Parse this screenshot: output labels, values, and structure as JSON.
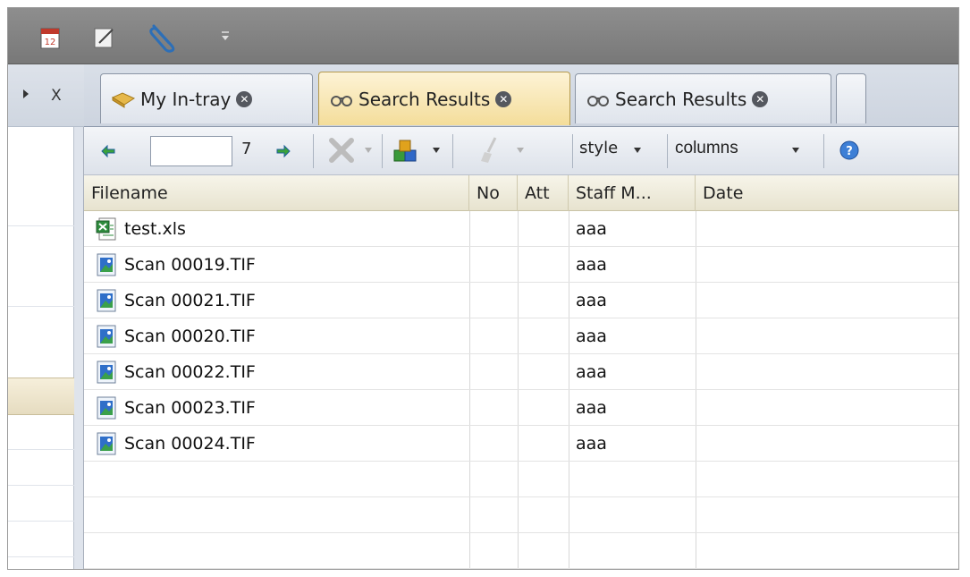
{
  "quick_access": {
    "icons": [
      "calendar-icon",
      "note-icon",
      "paperclip-icon",
      "customize-dropdown-icon"
    ],
    "calendar_number": "12"
  },
  "left_pane": {
    "close_label": "X"
  },
  "tabs": [
    {
      "label": "My In-tray",
      "icon": "in-tray-icon",
      "active": false
    },
    {
      "label": "Search Results",
      "icon": "binoculars-icon",
      "active": true
    },
    {
      "label": "Search Results",
      "icon": "binoculars-icon",
      "active": false
    },
    {
      "label": "",
      "icon": "",
      "active": false
    }
  ],
  "toolbar": {
    "page_value": "",
    "page_count": "7",
    "style_label": "style",
    "columns_label": "columns"
  },
  "grid": {
    "columns": [
      "Filename",
      "No",
      "Att",
      "Staff M...",
      "Date"
    ],
    "rows": [
      {
        "filename": "test.xls",
        "no": "",
        "att": "",
        "staff": "aaa",
        "date": "",
        "icon": "excel-file-icon"
      },
      {
        "filename": "Scan 00019.TIF",
        "no": "",
        "att": "",
        "staff": "aaa",
        "date": "",
        "icon": "image-file-icon"
      },
      {
        "filename": "Scan 00021.TIF",
        "no": "",
        "att": "",
        "staff": "aaa",
        "date": "",
        "icon": "image-file-icon"
      },
      {
        "filename": "Scan 00020.TIF",
        "no": "",
        "att": "",
        "staff": "aaa",
        "date": "",
        "icon": "image-file-icon"
      },
      {
        "filename": "Scan 00022.TIF",
        "no": "",
        "att": "",
        "staff": "aaa",
        "date": "",
        "icon": "image-file-icon"
      },
      {
        "filename": "Scan 00023.TIF",
        "no": "",
        "att": "",
        "staff": "aaa",
        "date": "",
        "icon": "image-file-icon"
      },
      {
        "filename": "Scan 00024.TIF",
        "no": "",
        "att": "",
        "staff": "aaa",
        "date": "",
        "icon": "image-file-icon"
      }
    ]
  },
  "colors": {
    "active_tab": "#f4dd9a",
    "toolbar_bg": "#dde2ea",
    "header_bg": "#e7e3cf"
  }
}
